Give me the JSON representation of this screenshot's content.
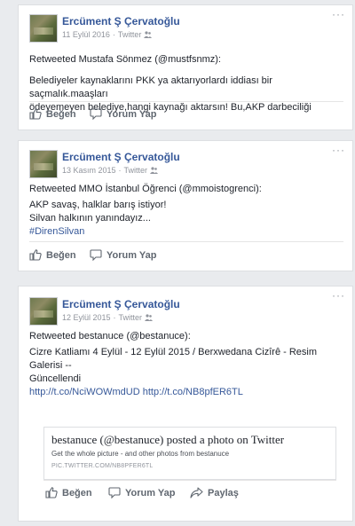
{
  "posts": [
    {
      "author": "Ercüment Ş Çervatoğlu",
      "date": "11 Eylül 2016",
      "via": "Twitter",
      "retweet": "Retweeted Mustafa Sönmez (@mustfsnmz):",
      "lines": [
        "Belediyeler kaynaklarını PKK ya aktarıyorlardı iddiası bir saçmalık.maaşları",
        "ödeyemeyen belediye,hangi kaynağı aktarsın! Bu,AKP darbeciliği"
      ],
      "actions": {
        "like": "Beğen",
        "comment": "Yorum Yap"
      }
    },
    {
      "author": "Ercüment Ş Çervatoğlu",
      "date": "13 Kasım 2015",
      "via": "Twitter",
      "retweet": "Retweeted MMO İstanbul Öğrenci (@mmoistogrenci):",
      "lines": [
        "AKP savaş, halklar barış istiyor!",
        "Silvan halkının yanındayız..."
      ],
      "hashtag": "#DirenSilvan",
      "actions": {
        "like": "Beğen",
        "comment": "Yorum Yap"
      }
    },
    {
      "author": "Ercüment Ş Çervatoğlu",
      "date": "12 Eylül 2015",
      "via": "Twitter",
      "retweet": "Retweeted bestanuce (@bestanuce):",
      "lines": [
        "Cizre Katliamı 4 Eylül - 12 Eylül 2015 / Berxwedana Cizîrê - Resim Galerisi --",
        "Güncellendi"
      ],
      "links": [
        "http://t.co/NciWOWmdUD",
        "http://t.co/NB8pfER6TL"
      ],
      "link_card": {
        "title": "bestanuce (@bestanuce) posted a photo on Twitter",
        "description": "Get the whole picture - and other photos from bestanuce",
        "url": "PIC.TWITTER.COM/NB8PFER6TL"
      },
      "actions": {
        "like": "Beğen",
        "comment": "Yorum Yap",
        "share": "Paylaş"
      }
    }
  ],
  "more_glyph": "···",
  "icons": {
    "like": "thumbs-up-icon",
    "comment": "comment-icon",
    "share": "share-icon",
    "audience": "friends-icon",
    "more": "more-options-icon"
  }
}
